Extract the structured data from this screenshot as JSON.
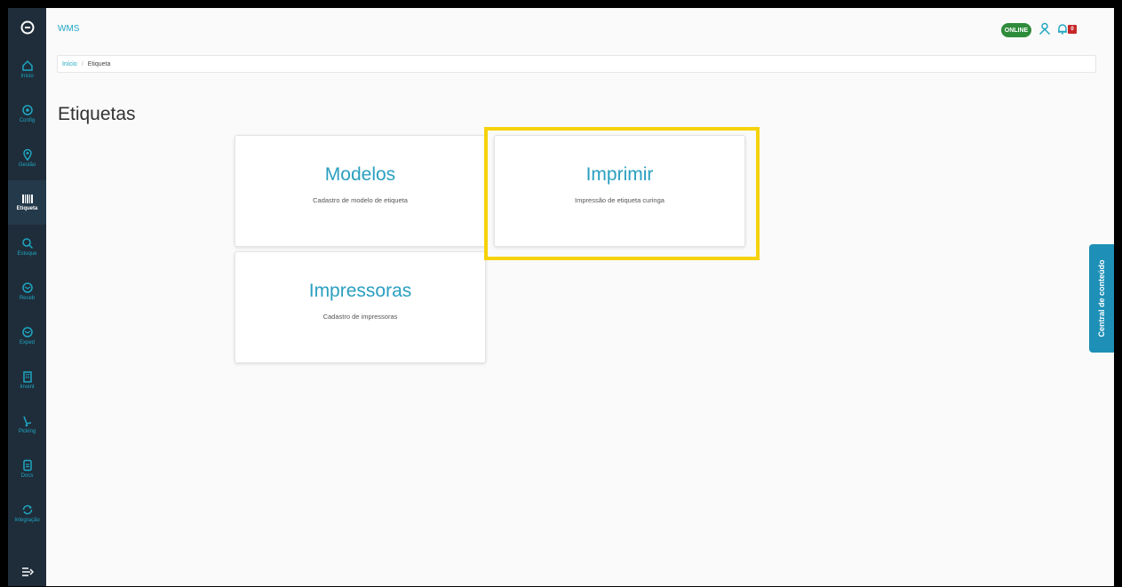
{
  "app": {
    "title": "WMS",
    "status": "ONLINE",
    "notifications": "0"
  },
  "colors": {
    "accent": "#1fa7c2",
    "sidebar": "#1f2d3a",
    "online": "#2e8b3a",
    "highlight": "#f5d20a"
  },
  "sidebar": {
    "items": [
      {
        "label": "Início",
        "icon": "home-icon"
      },
      {
        "label": "Config",
        "icon": "gear-icon"
      },
      {
        "label": "Gestão",
        "icon": "location-pin-icon"
      },
      {
        "label": "Etiqueta",
        "icon": "barcode-icon",
        "active": true
      },
      {
        "label": "Estoque",
        "icon": "search-icon"
      },
      {
        "label": "Receb",
        "icon": "box-icon"
      },
      {
        "label": "Exped",
        "icon": "box-icon"
      },
      {
        "label": "Invent",
        "icon": "building-icon"
      },
      {
        "label": "Picking",
        "icon": "hand-cart-icon"
      },
      {
        "label": "Docs",
        "icon": "document-icon"
      },
      {
        "label": "Integração",
        "icon": "sync-icon"
      }
    ]
  },
  "breadcrumb": {
    "home": "Início",
    "current": "Etiqueta"
  },
  "page": {
    "title": "Etiquetas"
  },
  "cards": [
    {
      "title": "Modelos",
      "subtitle": "Cadastro de modelo de etiqueta"
    },
    {
      "title": "Imprimir",
      "subtitle": "Impressão de etiqueta curinga"
    },
    {
      "title": "Impressoras",
      "subtitle": "Cadastro de impressoras"
    }
  ],
  "side_tab": {
    "label": "Central de conteúdo"
  }
}
